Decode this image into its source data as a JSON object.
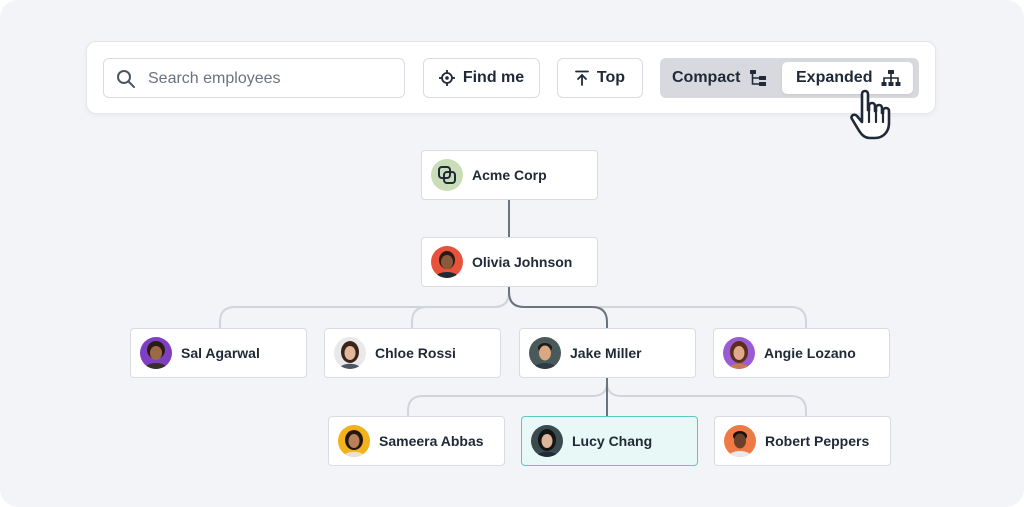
{
  "search": {
    "placeholder": "Search employees"
  },
  "toolbar": {
    "find_me_label": "Find me",
    "top_label": "Top",
    "compact_label": "Compact",
    "expanded_label": "Expanded",
    "active_view": "Expanded"
  },
  "org": {
    "company": {
      "name": "Acme Corp",
      "logo_icon": "overlapping-squares-icon"
    },
    "root": {
      "name": "Olivia Johnson"
    },
    "level2": [
      {
        "name": "Sal Agarwal"
      },
      {
        "name": "Chloe Rossi"
      },
      {
        "name": "Jake Miller"
      },
      {
        "name": "Angie Lozano"
      }
    ],
    "level3": [
      {
        "name": "Sameera Abbas"
      },
      {
        "name": "Lucy Chang",
        "selected": true
      },
      {
        "name": "Robert Peppers"
      }
    ]
  },
  "colors": {
    "background": "#f3f4f7",
    "selected_fill": "#e8f8f6",
    "selected_border": "#5ec8bd",
    "connector": "#6b7280",
    "connector_light": "#d1d5db"
  }
}
